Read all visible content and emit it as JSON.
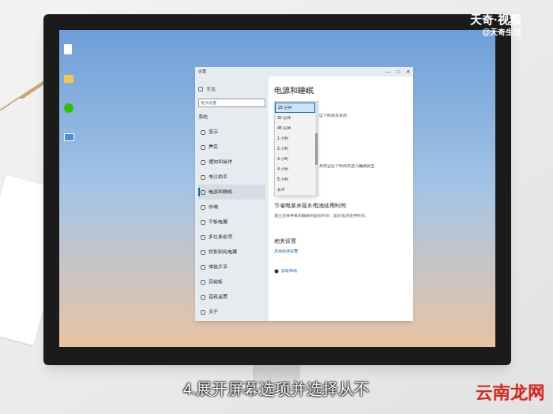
{
  "watermark": {
    "brand": "天奇·视频",
    "handle": "@天奇生活"
  },
  "window": {
    "title": "设置",
    "controls": [
      "—",
      "□",
      "✕"
    ]
  },
  "sidebar": {
    "home": "主页",
    "search_placeholder": "查找设置",
    "section": "系统",
    "items": [
      {
        "label": "显示",
        "selected": false
      },
      {
        "label": "声音",
        "selected": false
      },
      {
        "label": "通知和操作",
        "selected": false
      },
      {
        "label": "专注助手",
        "selected": false
      },
      {
        "label": "电源和睡眠",
        "selected": true
      },
      {
        "label": "存储",
        "selected": false
      },
      {
        "label": "平板电脑",
        "selected": false
      },
      {
        "label": "多任务处理",
        "selected": false
      },
      {
        "label": "投影到此电脑",
        "selected": false
      },
      {
        "label": "体验共享",
        "selected": false
      },
      {
        "label": "剪贴板",
        "selected": false
      },
      {
        "label": "远程桌面",
        "selected": false
      },
      {
        "label": "关于",
        "selected": false
      }
    ]
  },
  "content": {
    "heading": "电源和睡眠",
    "screen_hint": "以下时间后关闭",
    "sleep_hint": "后经过以下时间后进入睡眠状态",
    "battery_title": "节省电量并延长电池使用时间",
    "battery_desc": "通过选择屏幕和睡眠的较短时间，延长电池使用时间。",
    "related_title": "相关设置",
    "related_link": "其他电源设置",
    "help": "获取帮助"
  },
  "dropdown": {
    "expanded": true,
    "options": [
      {
        "label": "25 分钟",
        "selected": true
      },
      {
        "label": "30 分钟",
        "selected": false
      },
      {
        "label": "45 分钟",
        "selected": false
      },
      {
        "label": "1 小时",
        "selected": false
      },
      {
        "label": "2 小时",
        "selected": false
      },
      {
        "label": "3 小时",
        "selected": false
      },
      {
        "label": "4 小时",
        "selected": false
      },
      {
        "label": "5 小时",
        "selected": false
      },
      {
        "label": "从不",
        "selected": false
      }
    ]
  },
  "caption": "4.展开屏幕选项并选择从不",
  "site_logo": "云南龙网"
}
